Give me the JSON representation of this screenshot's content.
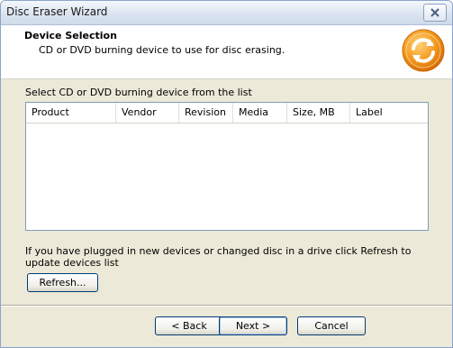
{
  "window": {
    "title": "Disc Eraser Wizard"
  },
  "header": {
    "title": "Device Selection",
    "subtitle": "CD or DVD burning device to use for disc erasing."
  },
  "device_list": {
    "label": "Select CD or DVD burning device from the list",
    "columns": [
      "Product",
      "Vendor",
      "Revision",
      "Media",
      "Size, MB",
      "Label"
    ],
    "rows": []
  },
  "info_text": "If you have plugged in new devices or changed disc in a drive click Refresh to update devices list",
  "buttons": {
    "refresh": "Refresh...",
    "back": "< Back",
    "next": "Next >",
    "cancel": "Cancel"
  },
  "colors": {
    "accent_orange": "#f39a1e",
    "border_blue": "#7f9db9"
  },
  "icons": {
    "close": "close-icon",
    "logo": "refresh-arrows-logo-icon"
  }
}
